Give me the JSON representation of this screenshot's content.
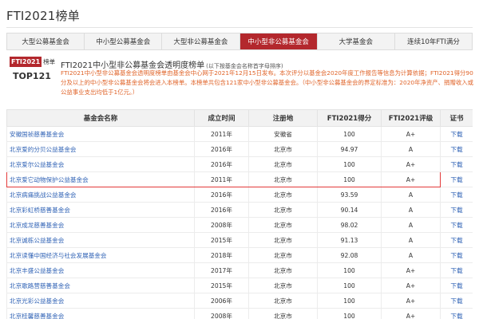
{
  "page_title": "FTI2021榜单",
  "tabs": [
    {
      "label": "大型公募基金会",
      "active": false
    },
    {
      "label": "中小型公募基金会",
      "active": false
    },
    {
      "label": "大型非公募基金会",
      "active": false
    },
    {
      "label": "中小型非公募基金会",
      "active": true
    },
    {
      "label": "大学基金会",
      "active": false
    },
    {
      "label": "连续10年FTI满分",
      "active": false
    }
  ],
  "logo": {
    "badge": "FTI2021",
    "rank": "榜单",
    "top": "TOP121"
  },
  "intro": {
    "title": "FTI2021中小型非公募基金会透明度榜单",
    "note": "(以下按基金会名称首字母排序)",
    "text": "FTI2021中小型非公募基金会透明度榜单由基金会中心网于2021年12月15日发布。本次评分以基金会2020年度工作报告等信息为计算依据；FTI2021得分90分及以上的中小型非公募基金会将会进入本榜单。本榜单共包含121家中小型非公募基金会。（中小型非公募基金会的界定标准为：2020年净资产、捐赠收入或公益事业支出均低于1亿元。）"
  },
  "table": {
    "headers": [
      "基金会名称",
      "成立时间",
      "注册地",
      "FTI2021得分",
      "FTI2021评级",
      "证书"
    ],
    "rows": [
      {
        "name": "安徽国祯慈善基金会",
        "year": "2011年",
        "place": "安徽省",
        "score": "100",
        "rating": "A+",
        "cert": "下载",
        "highlight": false
      },
      {
        "name": "北京爱的分贝公益基金会",
        "year": "2016年",
        "place": "北京市",
        "score": "94.97",
        "rating": "A",
        "cert": "下载",
        "highlight": false
      },
      {
        "name": "北京爱尔公益基金会",
        "year": "2016年",
        "place": "北京市",
        "score": "100",
        "rating": "A+",
        "cert": "下载",
        "highlight": false
      },
      {
        "name": "北京爱它动物保护公益基金会",
        "year": "2011年",
        "place": "北京市",
        "score": "100",
        "rating": "A+",
        "cert": "下载",
        "highlight": true
      },
      {
        "name": "北京病痛挑战公益基金会",
        "year": "2016年",
        "place": "北京市",
        "score": "93.59",
        "rating": "A",
        "cert": "下载",
        "highlight": false
      },
      {
        "name": "北京彩虹桥慈善基金会",
        "year": "2016年",
        "place": "北京市",
        "score": "90.14",
        "rating": "A",
        "cert": "下载",
        "highlight": false
      },
      {
        "name": "北京成龙慈善基金会",
        "year": "2008年",
        "place": "北京市",
        "score": "98.02",
        "rating": "A",
        "cert": "下载",
        "highlight": false
      },
      {
        "name": "北京诚栋公益基金会",
        "year": "2015年",
        "place": "北京市",
        "score": "91.13",
        "rating": "A",
        "cert": "下载",
        "highlight": false
      },
      {
        "name": "北京读懂中国经济与社会发展基金会",
        "year": "2018年",
        "place": "北京市",
        "score": "92.08",
        "rating": "A",
        "cert": "下载",
        "highlight": false
      },
      {
        "name": "北京丰盛公益基金会",
        "year": "2017年",
        "place": "北京市",
        "score": "100",
        "rating": "A+",
        "cert": "下载",
        "highlight": false
      },
      {
        "name": "北京歌路营慈善基金会",
        "year": "2015年",
        "place": "北京市",
        "score": "100",
        "rating": "A+",
        "cert": "下载",
        "highlight": false
      },
      {
        "name": "北京光彩公益基金会",
        "year": "2006年",
        "place": "北京市",
        "score": "100",
        "rating": "A+",
        "cert": "下载",
        "highlight": false
      },
      {
        "name": "北京桂馨慈善基金会",
        "year": "2008年",
        "place": "北京市",
        "score": "100",
        "rating": "A+",
        "cert": "下载",
        "highlight": false
      }
    ]
  }
}
